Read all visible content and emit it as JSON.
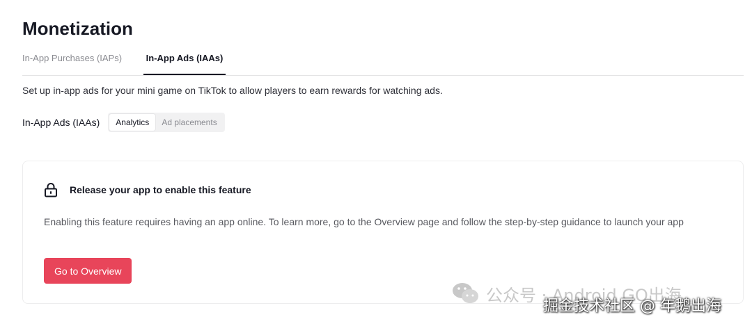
{
  "page": {
    "title": "Monetization"
  },
  "tabs": [
    {
      "label": "In-App Purchases (IAPs)",
      "active": false
    },
    {
      "label": "In-App Ads (IAAs)",
      "active": true
    }
  ],
  "description": "Set up in-app ads for your mini game on TikTok to allow players to earn rewards for watching ads.",
  "segment": {
    "label": "In-App Ads (IAAs)",
    "options": [
      {
        "label": "Analytics",
        "active": true
      },
      {
        "label": "Ad placements",
        "active": false
      }
    ]
  },
  "card": {
    "icon": "lock-icon",
    "title": "Release your app to enable this feature",
    "body": "Enabling this feature requires having an app online. To learn more, go to the Overview page and follow the step-by-step guidance to launch your app",
    "button_label": "Go to Overview"
  },
  "watermark": {
    "line1": "公众号 · Android GO出海",
    "line2": "掘金技术社区 @ 年鹅出海"
  },
  "colors": {
    "primary": "#e8455a",
    "text": "#161823",
    "muted": "#8a8b91",
    "border": "#e3e3e4"
  }
}
